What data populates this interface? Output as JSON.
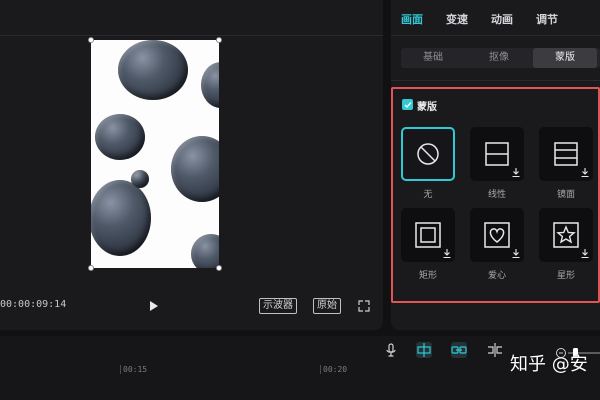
{
  "preview": {
    "timecode": "00:00:09:14",
    "waveform_button": "示波器",
    "original_button": "原始"
  },
  "panel": {
    "tabs": [
      {
        "label": "画面",
        "active": true
      },
      {
        "label": "变速",
        "active": false
      },
      {
        "label": "动画",
        "active": false
      },
      {
        "label": "调节",
        "active": false
      }
    ],
    "sub_tabs": [
      {
        "label": "基础",
        "active": false
      },
      {
        "label": "抠像",
        "active": false
      },
      {
        "label": "蒙版",
        "active": true
      }
    ],
    "mask": {
      "title": "蒙版",
      "enabled": true,
      "items": [
        {
          "label": "无",
          "icon": "none-icon",
          "selected": true
        },
        {
          "label": "线性",
          "icon": "linear-mask-icon",
          "selected": false
        },
        {
          "label": "镜面",
          "icon": "mirror-mask-icon",
          "selected": false
        },
        {
          "label": "矩形",
          "icon": "rectangle-mask-icon",
          "selected": false
        },
        {
          "label": "爱心",
          "icon": "heart-mask-icon",
          "selected": false
        },
        {
          "label": "星形",
          "icon": "star-mask-icon",
          "selected": false
        }
      ]
    }
  },
  "timeline": {
    "ticks": [
      "00:15",
      "00:20"
    ]
  },
  "watermark": "知乎 @安",
  "colors": {
    "accent": "#31c9d4",
    "highlight_border": "#e05555"
  }
}
